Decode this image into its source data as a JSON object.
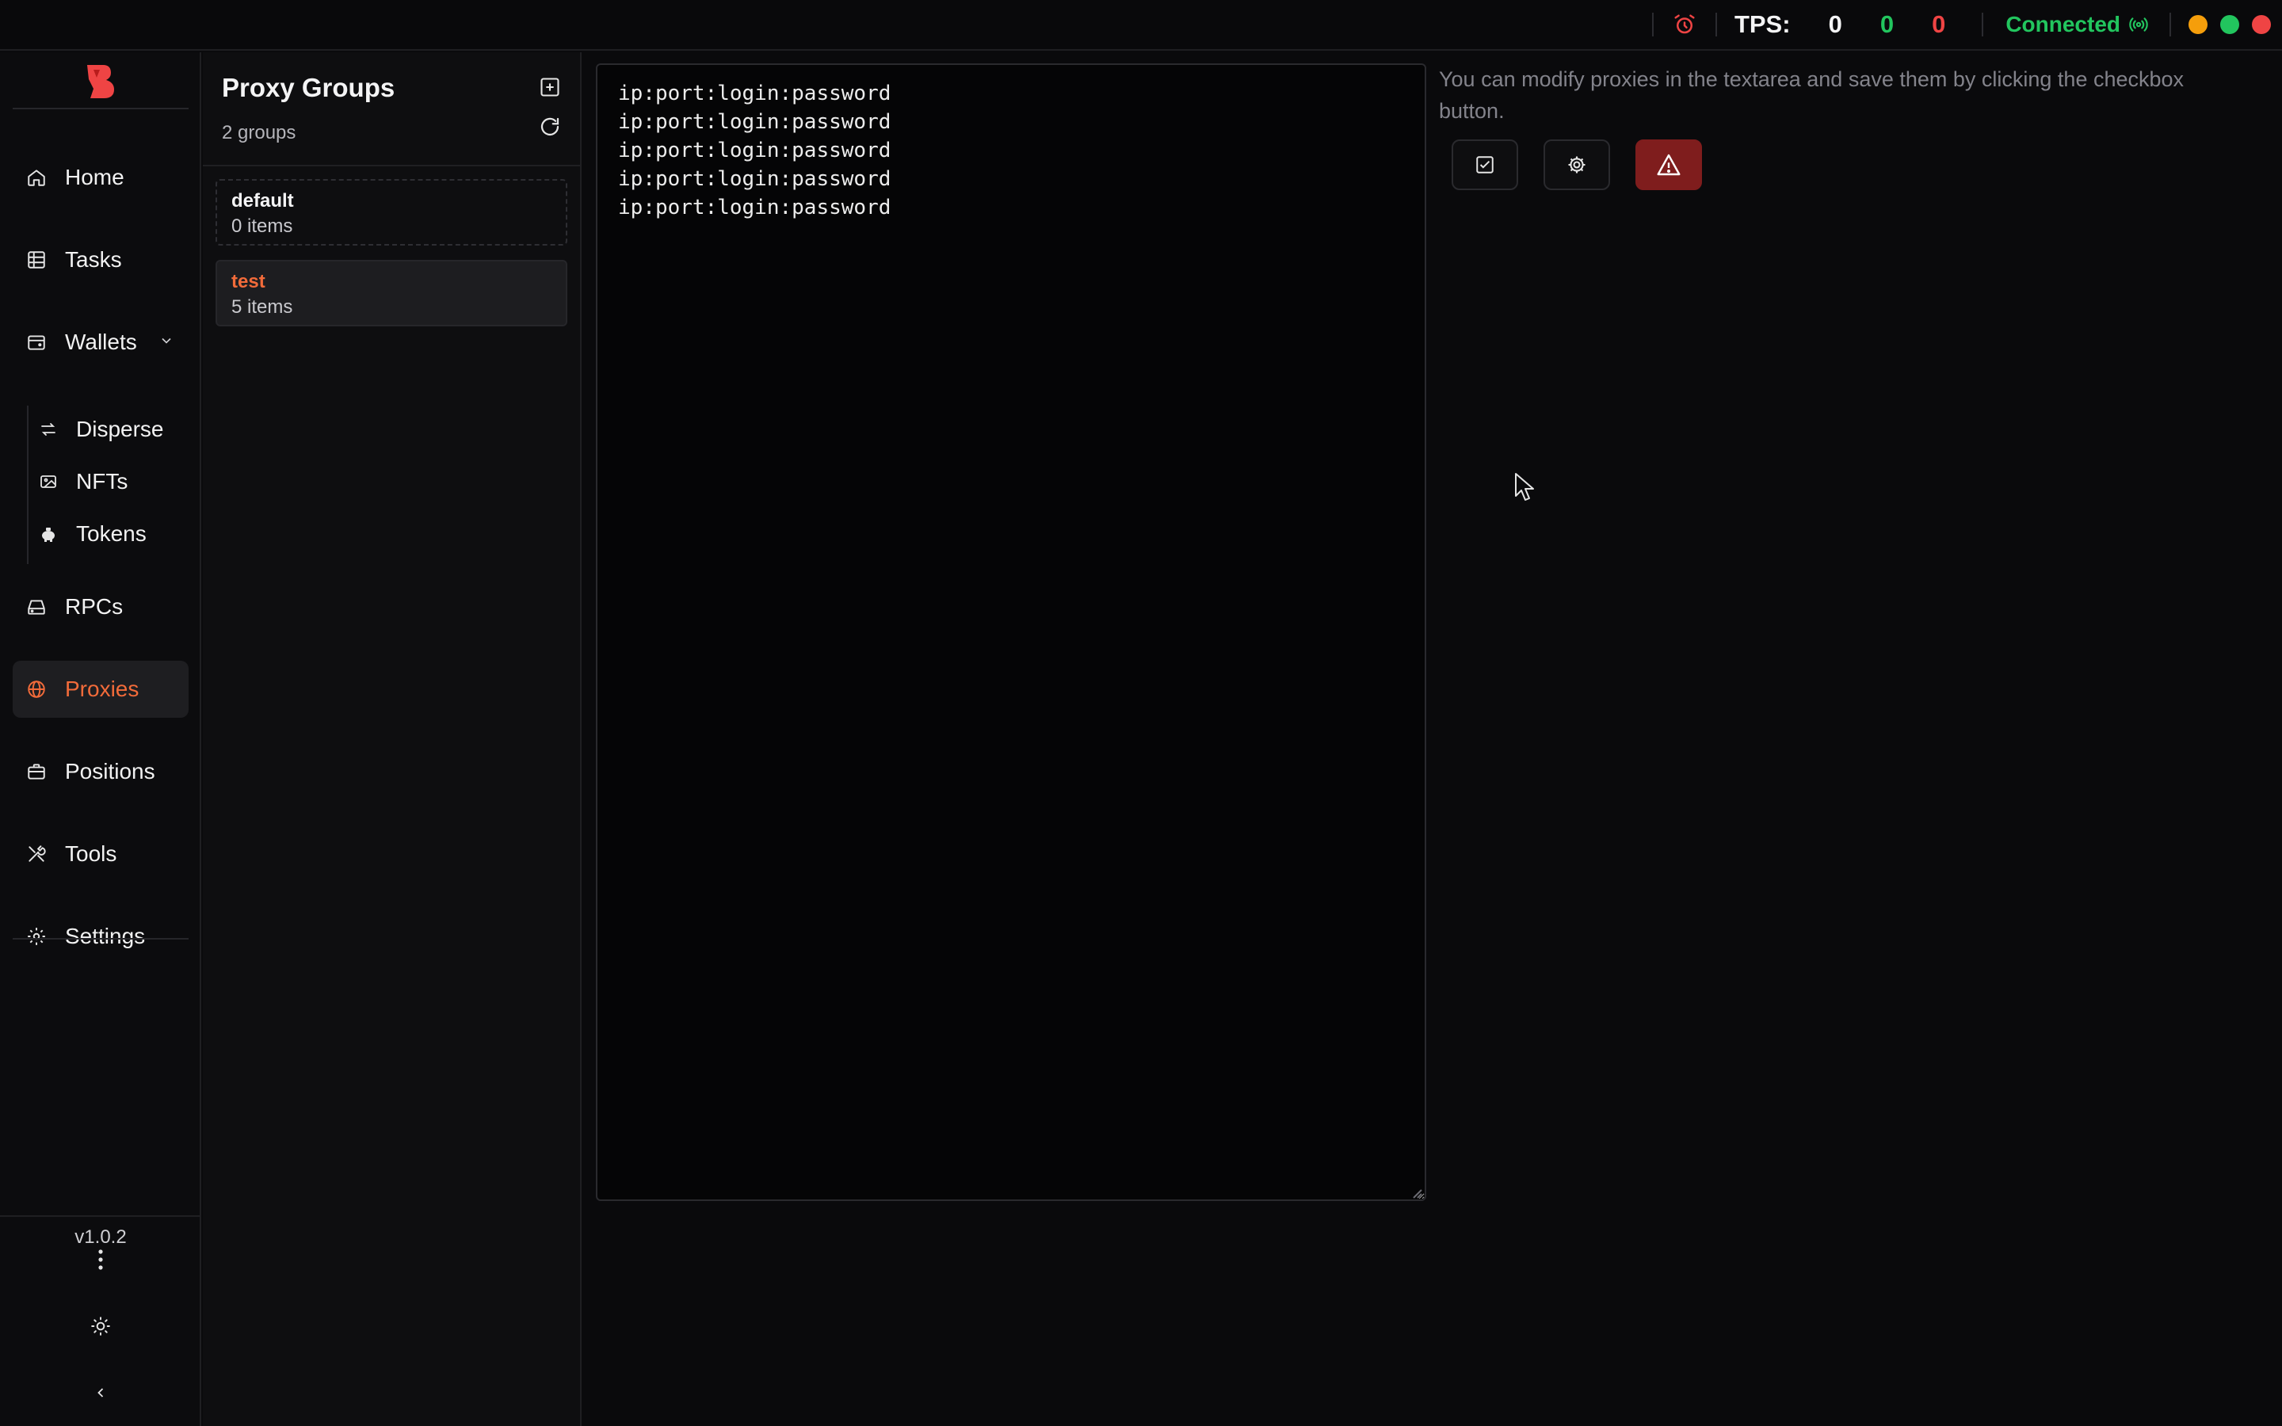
{
  "topbar": {
    "tps_label": "TPS:",
    "tps_values": [
      "0",
      "0",
      "0"
    ],
    "status": "Connected",
    "colors": {
      "green": "#22c55e",
      "red": "#ef4444",
      "accent": "#f26b3a"
    }
  },
  "sidebar": {
    "items": [
      {
        "label": "Home",
        "icon": "home-icon"
      },
      {
        "label": "Tasks",
        "icon": "table-icon"
      },
      {
        "label": "Wallets",
        "icon": "wallet-icon"
      },
      {
        "label": "RPCs",
        "icon": "drive-icon"
      },
      {
        "label": "Proxies",
        "icon": "globe-icon",
        "active": true
      },
      {
        "label": "Positions",
        "icon": "briefcase-icon"
      },
      {
        "label": "Tools",
        "icon": "tools-icon"
      },
      {
        "label": "Settings",
        "icon": "gear-icon"
      }
    ],
    "sub_items": [
      {
        "label": "Disperse",
        "icon": "arrows-icon"
      },
      {
        "label": "NFTs",
        "icon": "image-icon"
      },
      {
        "label": "Tokens",
        "icon": "piggy-bank-icon"
      }
    ],
    "version": "v1.0.2"
  },
  "groups": {
    "title": "Proxy Groups",
    "count": "2 groups",
    "list": [
      {
        "name": "default",
        "items": "0 items"
      },
      {
        "name": "test",
        "items": "5 items",
        "selected": true
      }
    ]
  },
  "editor": {
    "content": "ip:port:login:password\nip:port:login:password\nip:port:login:password\nip:port:login:password\nip:port:login:password"
  },
  "main": {
    "hint": "You can modify proxies in the textarea and save them by clicking the checkbox button."
  }
}
